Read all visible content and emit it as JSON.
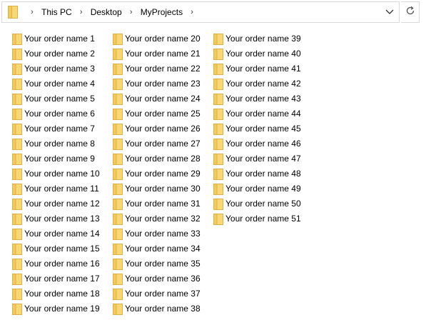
{
  "address_bar": {
    "breadcrumbs": [
      "This PC",
      "Desktop",
      "MyProjects"
    ],
    "separator_icon": "chevron-right-icon",
    "folder_icon": "folder-icon",
    "dropdown_icon": "chevron-down-icon"
  },
  "refresh_icon": "refresh-icon",
  "colors": {
    "folder_fill": "#f8d775",
    "folder_edge": "#dcb149",
    "border": "#d9d9d9"
  },
  "folders": [
    "Your order name 1",
    "Your order name 2",
    "Your order name 3",
    "Your order name 4",
    "Your order name 5",
    "Your order name 6",
    "Your order name 7",
    "Your order name 8",
    "Your order name 9",
    "Your order name 10",
    "Your order name 11",
    "Your order name 12",
    "Your order name 13",
    "Your order name 14",
    "Your order name 15",
    "Your order name 16",
    "Your order name 17",
    "Your order name 18",
    "Your order name 19",
    "Your order name 20",
    "Your order name 21",
    "Your order name 22",
    "Your order name 23",
    "Your order name 24",
    "Your order name 25",
    "Your order name 26",
    "Your order name 27",
    "Your order name 28",
    "Your order name 29",
    "Your order name 30",
    "Your order name 31",
    "Your order name 32",
    "Your order name 33",
    "Your order name 34",
    "Your order name 35",
    "Your order name 36",
    "Your order name 37",
    "Your order name 38",
    "Your order name 39",
    "Your order name 40",
    "Your order name 41",
    "Your order name 42",
    "Your order name 43",
    "Your order name 44",
    "Your order name 45",
    "Your order name 46",
    "Your order name 47",
    "Your order name 48",
    "Your order name 49",
    "Your order name 50",
    "Your order name 51"
  ]
}
